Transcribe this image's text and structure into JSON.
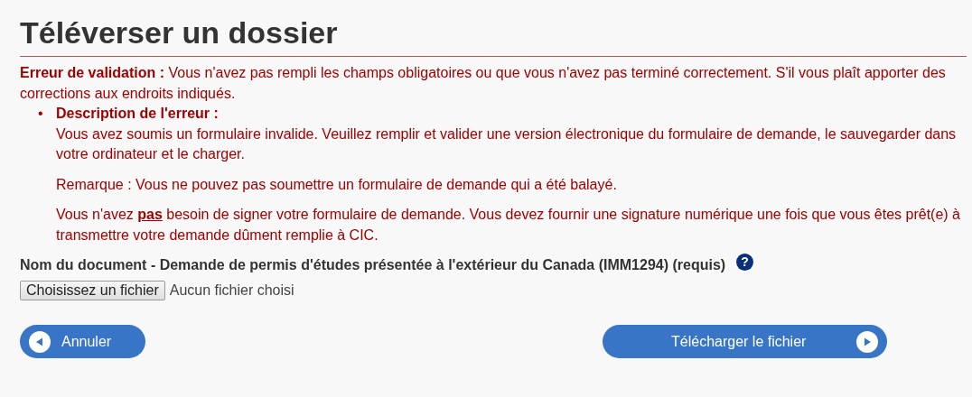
{
  "page_title": "Téléverser un dossier",
  "error": {
    "heading": "Erreur de validation :",
    "message": "Vous n'avez pas rempli les champs obligatoires ou que vous n'avez pas terminé correctement. S'il vous plaît apporter des corrections aux endroits indiqués.",
    "items": [
      {
        "bullet": "•",
        "heading": "Description de l'erreur :",
        "paragraphs": [
          "Vous avez soumis un formulaire invalide. Veuillez remplir et valider une version électronique du formulaire de demande, le sauvegarder dans votre ordinateur et le charger.",
          "Remarque : Vous ne pouvez pas soumettre un formulaire de demande qui a été balayé.",
          "Vous n'avez **pas** besoin de signer votre formulaire de demande.  Vous devez fournir une signature numérique une fois que vous êtes prêt(e) à transmettre votre demande dûment remplie à CIC."
        ]
      }
    ]
  },
  "field": {
    "label": "Nom du document - Demande de permis d'études présentée à l'extérieur du Canada (IMM1294) (requis)",
    "help": "?",
    "button_label": "Choisissez un fichier",
    "status": "Aucun fichier choisi"
  },
  "buttons": [
    {
      "label": "Annuler",
      "kind": "back"
    },
    {
      "label": "Télécharger le fichier",
      "kind": "next"
    }
  ]
}
